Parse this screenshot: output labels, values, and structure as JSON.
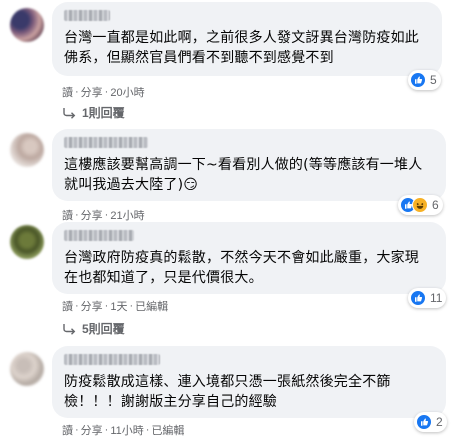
{
  "comments": [
    {
      "text": "台灣一直都是如此啊，之前很多人發文訝異台灣防疫如此\n佛系，但顯然官員們看不到聽不到感覺不到",
      "reaction_count": "5",
      "reactions": [
        "like-icon"
      ],
      "actions": {
        "reply": "讀",
        "share": "分享",
        "time": "20小時"
      },
      "replies_label": "1則回覆"
    },
    {
      "text": "這樓應該要幫高調一下~看看別人做的(等等應該有一堆人\n就叫我過去大陸了)😏",
      "reaction_count": "6",
      "reactions": [
        "like-icon",
        "haha-icon"
      ],
      "actions": {
        "reply": "讀",
        "share": "分享",
        "time": "21小時"
      }
    },
    {
      "text": "台灣政府防疫真的鬆散，不然今天不會如此嚴重，大家現\n在也都知道了，只是代價很大。",
      "reaction_count": "11",
      "reactions": [
        "like-icon"
      ],
      "actions": {
        "reply": "讀",
        "share": "分享",
        "time": "1天",
        "edited": "已編輯"
      },
      "replies_label": "5則回覆"
    },
    {
      "text": "防疫鬆散成這樣、連入境都只憑一張紙然後完全不篩\n檢！！！謝謝版主分享自己的經驗",
      "reaction_count": "2",
      "reactions": [
        "like-icon"
      ],
      "actions": {
        "reply": "讀",
        "share": "分享",
        "time": "11小時",
        "edited": "已編輯"
      }
    }
  ],
  "colors": {
    "like": "#1877f2",
    "haha": "#f7b125",
    "bubble": "#f0f2f5",
    "meta_text": "#65676b"
  }
}
